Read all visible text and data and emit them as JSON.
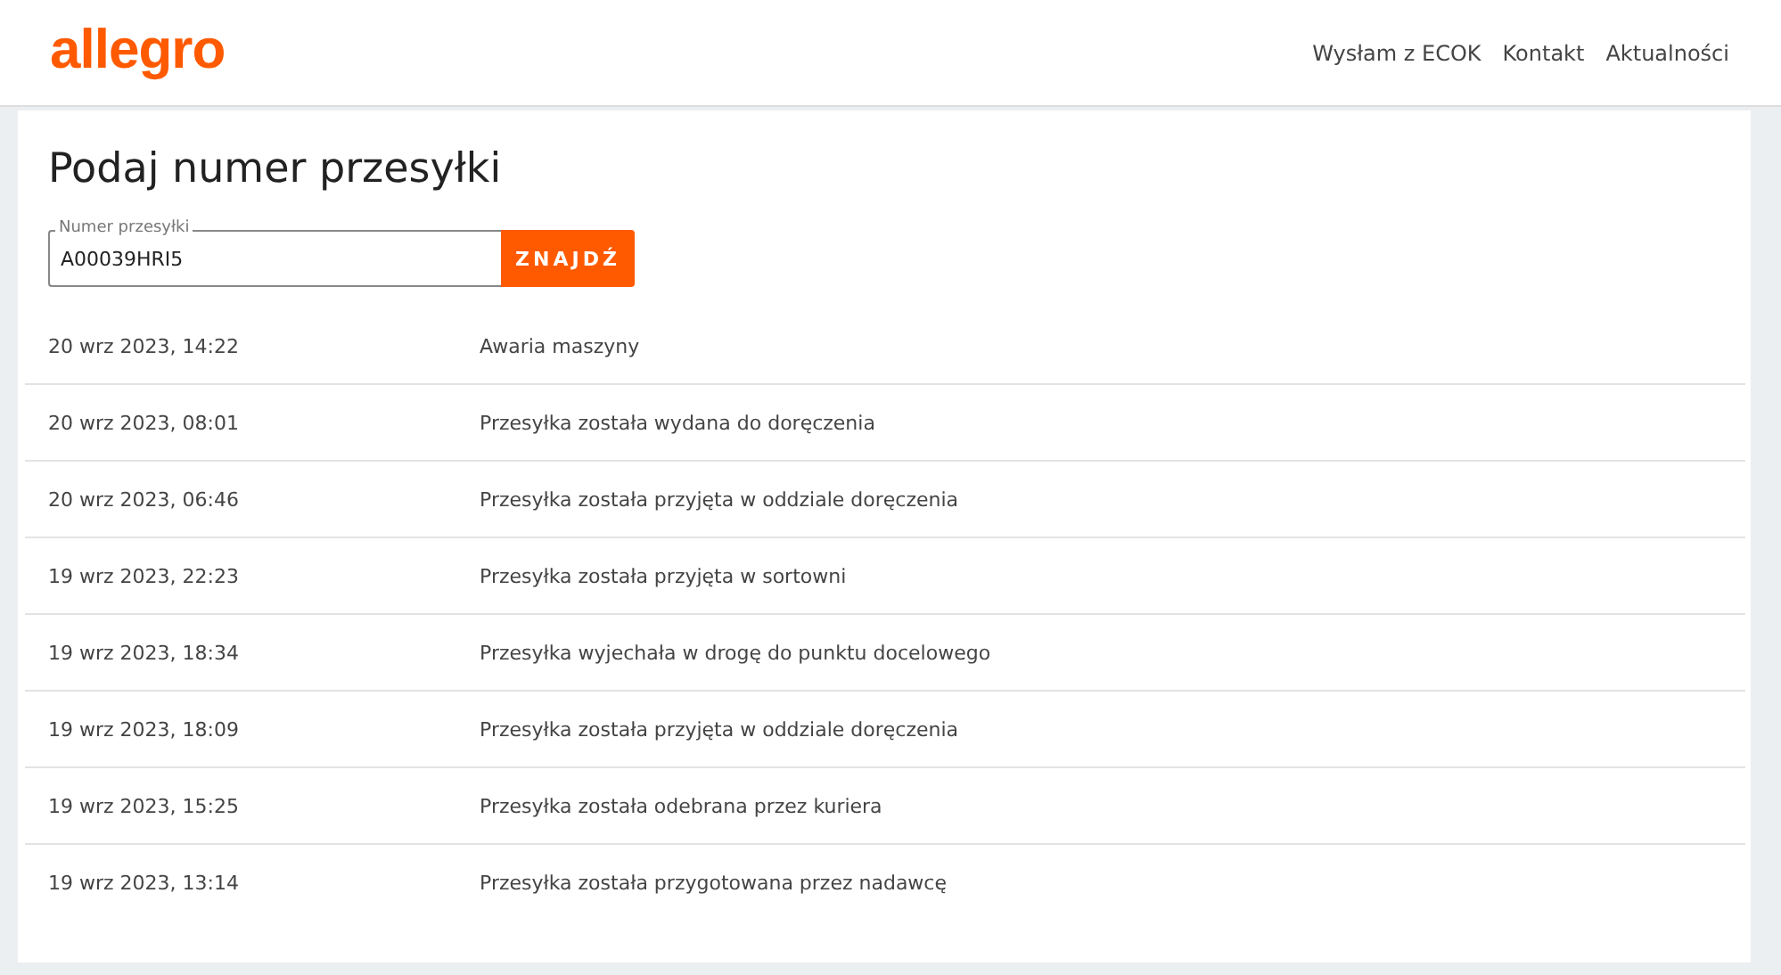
{
  "header": {
    "logo": "allegro",
    "nav": [
      "Wysłam z ECOK",
      "Kontakt",
      "Aktualności"
    ]
  },
  "page": {
    "title": "Podaj numer przesyłki",
    "field": {
      "label": "Numer przesyłki",
      "value": "A00039HRI5"
    },
    "button": "ZNAJDŹ"
  },
  "events": [
    {
      "time": "20 wrz 2023, 14:22",
      "status": "Awaria maszyny"
    },
    {
      "time": "20 wrz 2023, 08:01",
      "status": "Przesyłka została wydana do doręczenia"
    },
    {
      "time": "20 wrz 2023, 06:46",
      "status": "Przesyłka została przyjęta w oddziale doręczenia"
    },
    {
      "time": "19 wrz 2023, 22:23",
      "status": "Przesyłka została przyjęta w sortowni"
    },
    {
      "time": "19 wrz 2023, 18:34",
      "status": "Przesyłka wyjechała w drogę do punktu docelowego"
    },
    {
      "time": "19 wrz 2023, 18:09",
      "status": "Przesyłka została przyjęta w oddziale doręczenia"
    },
    {
      "time": "19 wrz 2023, 15:25",
      "status": "Przesyłka została odebrana przez kuriera"
    },
    {
      "time": "19 wrz 2023, 13:14",
      "status": "Przesyłka została przygotowana przez nadawcę"
    }
  ]
}
